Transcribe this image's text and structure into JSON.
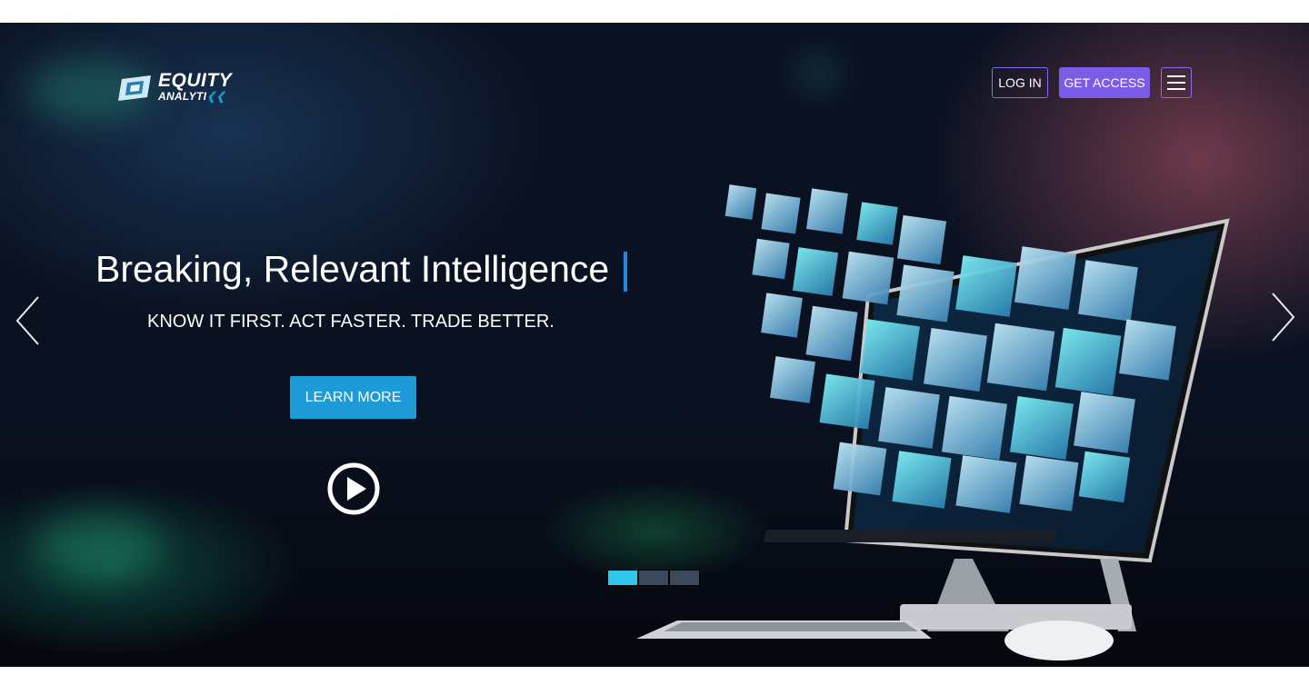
{
  "brand": {
    "line1": "EQUITY",
    "line2": "ANALYTI",
    "accent": "#1e9ad6"
  },
  "nav": {
    "login_label": "LOG IN",
    "access_label": "GET ACCESS",
    "menu_icon": "hamburger-icon",
    "button_color": "#7b5ce6"
  },
  "hero": {
    "headline": "Breaking, Relevant Intelligence",
    "tagline": "KNOW IT FIRST. ACT FASTER. TRADE BETTER.",
    "cta_label": "LEARN MORE",
    "cta_color": "#1e9ad6",
    "play_icon": "play-circle-icon",
    "prev_icon": "chevron-left-icon",
    "next_icon": "chevron-right-icon"
  },
  "carousel": {
    "slides": 3,
    "active_index": 0,
    "active_color": "#2fc8ec"
  }
}
